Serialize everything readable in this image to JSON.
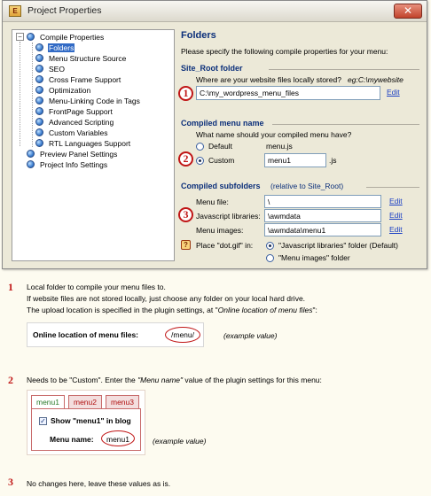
{
  "window": {
    "title": "Project Properties",
    "app_icon": "E",
    "close_label": "✕"
  },
  "tree": {
    "items": [
      {
        "label": "Compile Properties",
        "icon": "gear-icon",
        "expander": "−"
      },
      {
        "label": "Folders",
        "icon": "gear-icon",
        "selected": true
      },
      {
        "label": "Menu Structure Source",
        "icon": "gear-icon"
      },
      {
        "label": "SEO",
        "icon": "gear-icon"
      },
      {
        "label": "Cross Frame Support",
        "icon": "gear-icon"
      },
      {
        "label": "Optimization",
        "icon": "gear-icon"
      },
      {
        "label": "Menu-Linking Code in Tags",
        "icon": "gear-icon"
      },
      {
        "label": "FrontPage Support",
        "icon": "gear-icon"
      },
      {
        "label": "Advanced Scripting",
        "icon": "gear-icon"
      },
      {
        "label": "Custom Variables",
        "icon": "gear-icon"
      },
      {
        "label": "RTL Languages Support",
        "icon": "gear-icon"
      },
      {
        "label": "Preview Panel Settings",
        "icon": "gear-icon"
      },
      {
        "label": "Project Info Settings",
        "icon": "gear-icon"
      }
    ]
  },
  "panel": {
    "title": "Folders",
    "intro": "Please specify the following compile properties for your menu:",
    "site_root": {
      "title": "Site_Root folder",
      "question": "Where are your website files locally stored?",
      "example": "eg:C:\\mywebsite",
      "value": "C:\\my_wordpress_menu_files",
      "edit": "Edit",
      "marker": "1"
    },
    "compiled_name": {
      "title": "Compiled menu name",
      "question": "What name should your compiled menu have?",
      "default_label": "Default",
      "default_value": "menu.js",
      "custom_label": "Custom",
      "custom_value": "menu1",
      "ext": ".js",
      "marker": "2"
    },
    "subfolders": {
      "title": "Compiled subfolders",
      "subtitle": "(relative to Site_Root)",
      "menu_file_label": "Menu file:",
      "menu_file_value": "\\",
      "js_label": "Javascript libraries:",
      "js_value": "\\awmdata",
      "images_label": "Menu images:",
      "images_value": "\\awmdata\\menu1",
      "edit": "Edit",
      "marker": "3",
      "help": "?",
      "place_label": "Place \"dot.gif\" in:",
      "option1": "\"Javascript libraries\" folder (Default)",
      "option2": "\"Menu images\" folder"
    }
  },
  "explanations": {
    "one": {
      "num": "1",
      "line1": "Local folder to compile your menu files to.",
      "line2": "If website files are not stored locally, just choose any folder on your local hard drive.",
      "line3_pre": "The upload location is specified in the plugin settings, at \"",
      "line3_em": "Online location of menu files",
      "line3_post": "\":",
      "mini_label": "Online location of menu files:",
      "mini_value": "/menu/",
      "example_note": "(example value)"
    },
    "two": {
      "num": "2",
      "pre": "Needs to be \"Custom\". Enter the ",
      "em": "\"Menu name\"",
      "post": " value of the plugin settings for this menu:",
      "tabs": [
        "menu1",
        "menu2",
        "menu3"
      ],
      "checkbox_label": "Show \"menu1\" in blog",
      "name_label": "Menu name:",
      "name_value": "menu1",
      "example_note": "(example value)"
    },
    "three": {
      "num": "3",
      "text": "No changes here, leave these values as is."
    }
  }
}
